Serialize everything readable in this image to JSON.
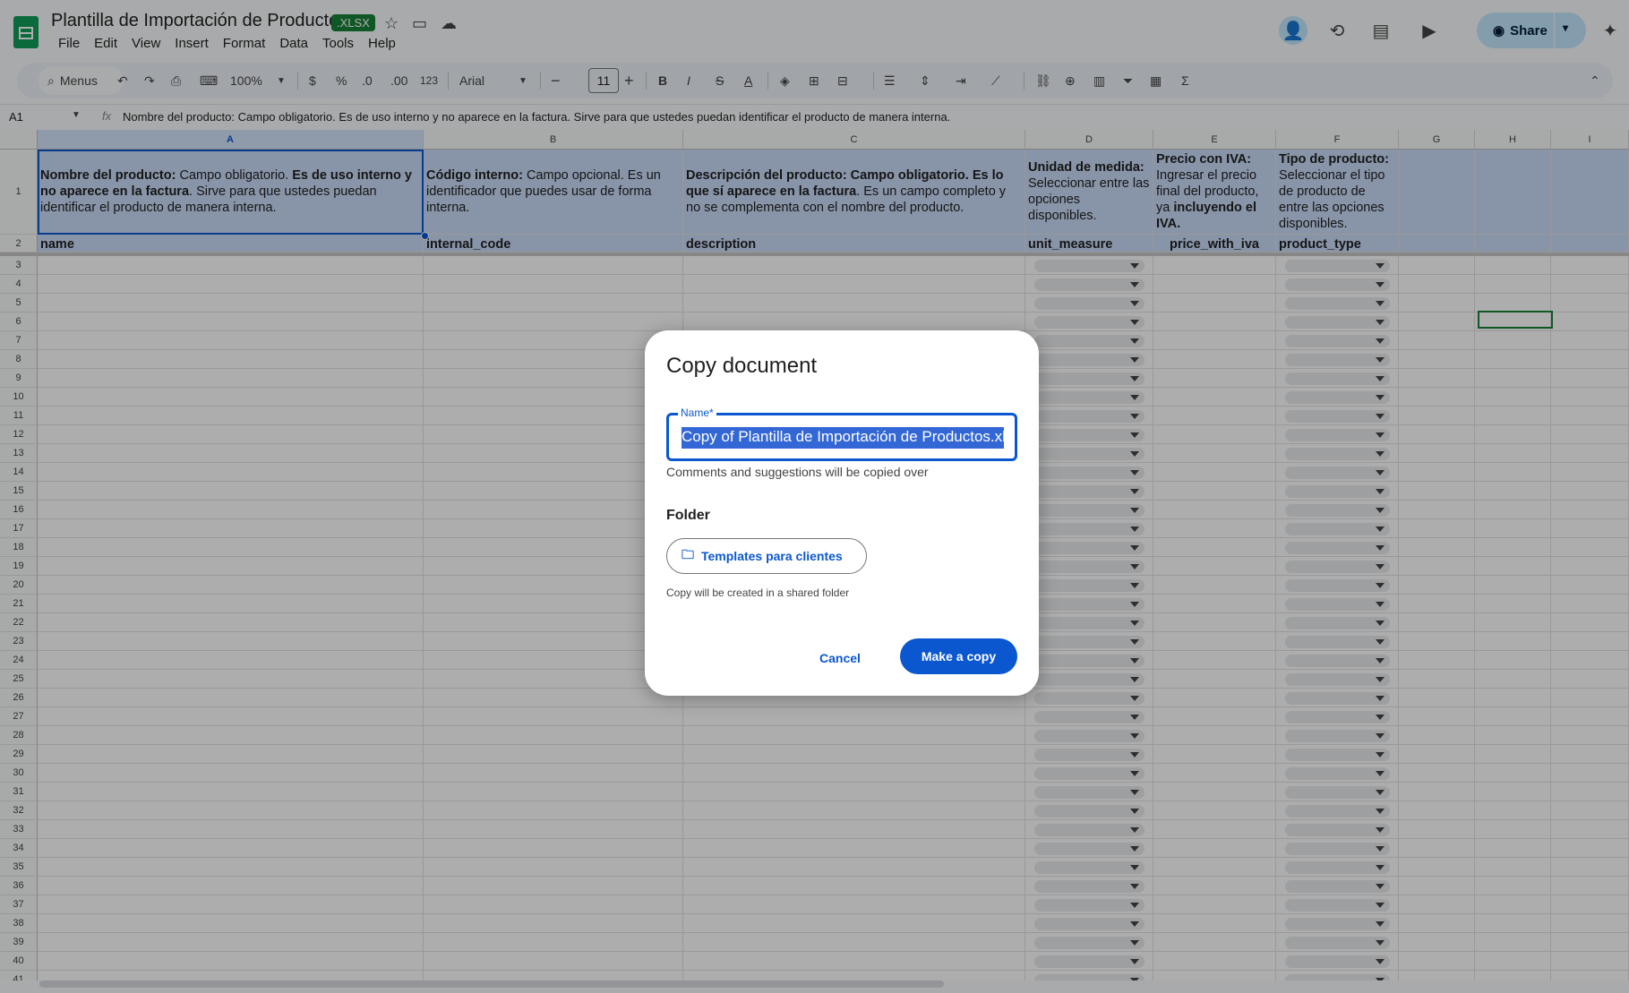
{
  "app": {
    "doc_title": "Plantilla de Importación de Productos",
    "file_badge": ".XLSX",
    "menus": [
      "File",
      "Edit",
      "View",
      "Insert",
      "Format",
      "Data",
      "Tools",
      "Help"
    ],
    "share_label": "Share"
  },
  "toolbar": {
    "search_label": "Menus",
    "zoom": "100%",
    "currency": "$",
    "percent": "%",
    "dec_decrease": ".0",
    "dec_increase": ".00",
    "number_format": "123",
    "font": "Arial",
    "font_size": "11",
    "bold": "B",
    "italic": "I",
    "strike": "S",
    "text_color": "A"
  },
  "formula_bar": {
    "cell_ref": "A1",
    "fx": "fx",
    "content": "Nombre del producto: Campo obligatorio. Es de uso interno y no aparece en la factura. Sirve para que ustedes puedan identificar el producto de manera interna."
  },
  "columns": [
    "A",
    "B",
    "C",
    "D",
    "E",
    "F",
    "G",
    "H",
    "I"
  ],
  "row1": {
    "a_b1": "Nombre del producto:",
    "a_t1": " Campo obligatorio. ",
    "a_b2": "Es de uso interno y no aparece en la factura",
    "a_t2": ". Sirve para que ustedes puedan identificar el producto de manera interna.",
    "b_b1": "Código interno:",
    "b_t1": " Campo opcional. Es un identificador que puedes usar de forma interna.",
    "c_b1": "Descripción del producto: Campo obligatorio. Es lo que sí aparece en la factura",
    "c_t1": ". Es un campo completo y no se complementa con el nombre del producto.",
    "d_b1": "Unidad de medida:",
    "d_t1": " Seleccionar entre las opciones disponibles.",
    "e_b1": "Precio con IVA:",
    "e_t1": " Ingresar el precio final del producto, ya ",
    "e_b2": "incluyendo el IVA.",
    "f_b1": "Tipo de producto:",
    "f_t1": " Seleccionar el tipo de producto de entre las opciones disponibles."
  },
  "row2": [
    "name",
    "internal_code",
    "description",
    "unit_measure",
    "price_with_iva",
    "product_type"
  ],
  "row_numbers": [
    "1",
    "2",
    "3",
    "4",
    "5",
    "6",
    "7",
    "8",
    "9",
    "10",
    "11",
    "12",
    "13",
    "14",
    "15",
    "16",
    "17",
    "18",
    "19",
    "20",
    "21",
    "22",
    "23",
    "24",
    "25",
    "26",
    "27",
    "28",
    "29",
    "30",
    "31",
    "32",
    "33",
    "34",
    "35",
    "36",
    "37",
    "38",
    "39",
    "40",
    "41"
  ],
  "dialog": {
    "title": "Copy document",
    "name_label": "Name*",
    "name_value": "Copy of Plantilla de Importación de Productos.xlsx",
    "helper": "Comments and suggestions will be copied over",
    "folder_heading": "Folder",
    "folder_name": "Templates para clientes",
    "folder_note": "Copy will be created in a shared folder",
    "cancel": "Cancel",
    "confirm": "Make a copy"
  }
}
